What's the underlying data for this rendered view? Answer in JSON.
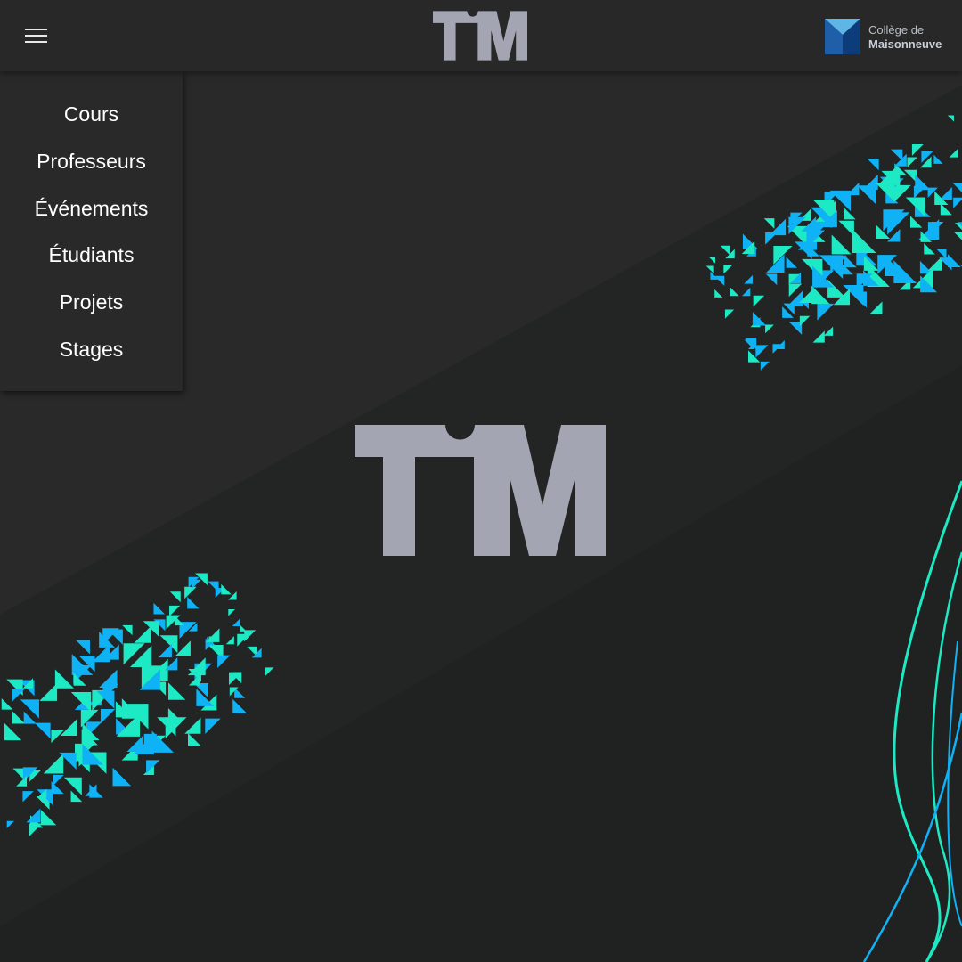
{
  "app": {
    "logo_text": "TIM",
    "logo_color": "#a3a6b2"
  },
  "header": {
    "menu_icon": "hamburger-icon",
    "college": {
      "line1": "Collège de",
      "line2": "Maisonneuve",
      "mark_colors": [
        "#1f5ea8",
        "#5fb6e6",
        "#0c3d7a"
      ]
    }
  },
  "menu": {
    "items": [
      {
        "label": "Cours"
      },
      {
        "label": "Professeurs"
      },
      {
        "label": "Événements"
      },
      {
        "label": "Étudiants"
      },
      {
        "label": "Projets"
      },
      {
        "label": "Stages"
      }
    ]
  },
  "decor": {
    "accent_cyan": "#1de9c4",
    "accent_blue": "#0fb2f5",
    "background": "#232424"
  }
}
